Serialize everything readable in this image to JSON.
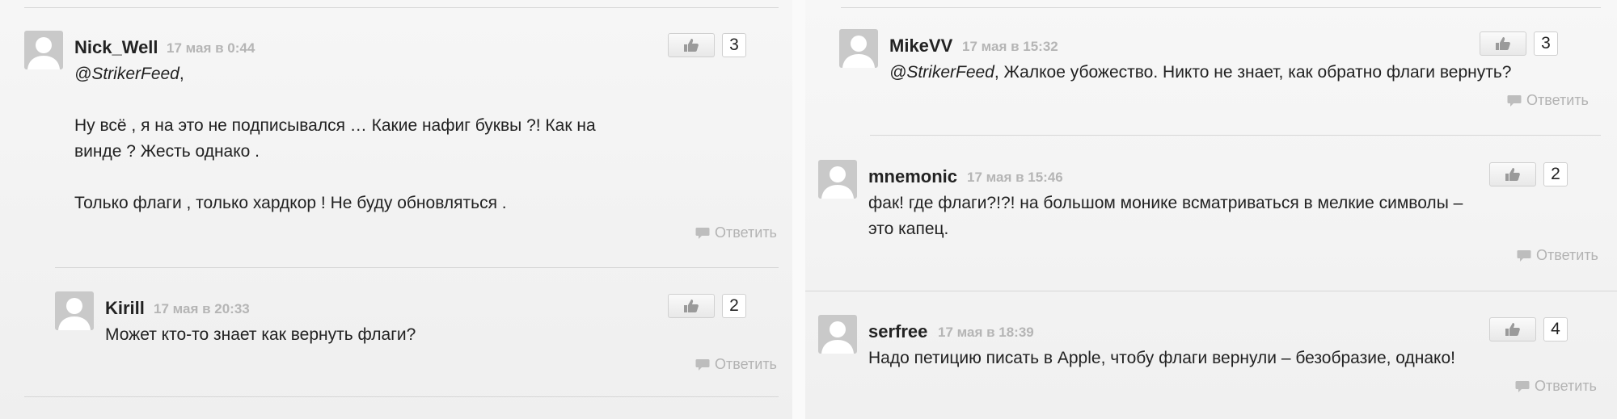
{
  "reply_label": "Ответить",
  "icons": {
    "like": "thumbs-up-icon",
    "reply": "speech-bubble-icon",
    "avatar": "default-user-avatar"
  },
  "colors": {
    "background": "#f2f2f2",
    "meta_text": "#b5b5b5",
    "avatar": "#c9c9c9"
  },
  "comments": [
    {
      "username": "Nick_Well",
      "timestamp": "17 мая в 0:44",
      "mention": "@StrikerFeed",
      "text_after_mention": ",",
      "paragraphs": [
        "Ну всё , я на это не подписывался … Какие нафиг буквы ?! Как на винде ? Жесть однако .",
        "Только флаги , только хардкор ! Не буду обновляться ."
      ],
      "likes": "3"
    },
    {
      "username": "Kirill",
      "timestamp": "17 мая в 20:33",
      "text": "Может кто-то знает как вернуть флаги?",
      "likes": "2"
    },
    {
      "username": "MikeVV",
      "timestamp": "17 мая в 15:32",
      "mention": "@StrikerFeed",
      "text_after_mention": ", Жалкое убожество. Никто не знает, как обратно флаги вернуть?",
      "likes": "3"
    },
    {
      "username": "mnemonic",
      "timestamp": "17 мая в 15:46",
      "text": "фак! где флаги?!?! на большом монике всматриваться в мелкие символы – это капец.",
      "likes": "2"
    },
    {
      "username": "serfree",
      "timestamp": "17 мая в 18:39",
      "text": "Надо петицию писать в Apple, чтобу флаги вернули – безобразие, однако!",
      "likes": "4"
    }
  ]
}
